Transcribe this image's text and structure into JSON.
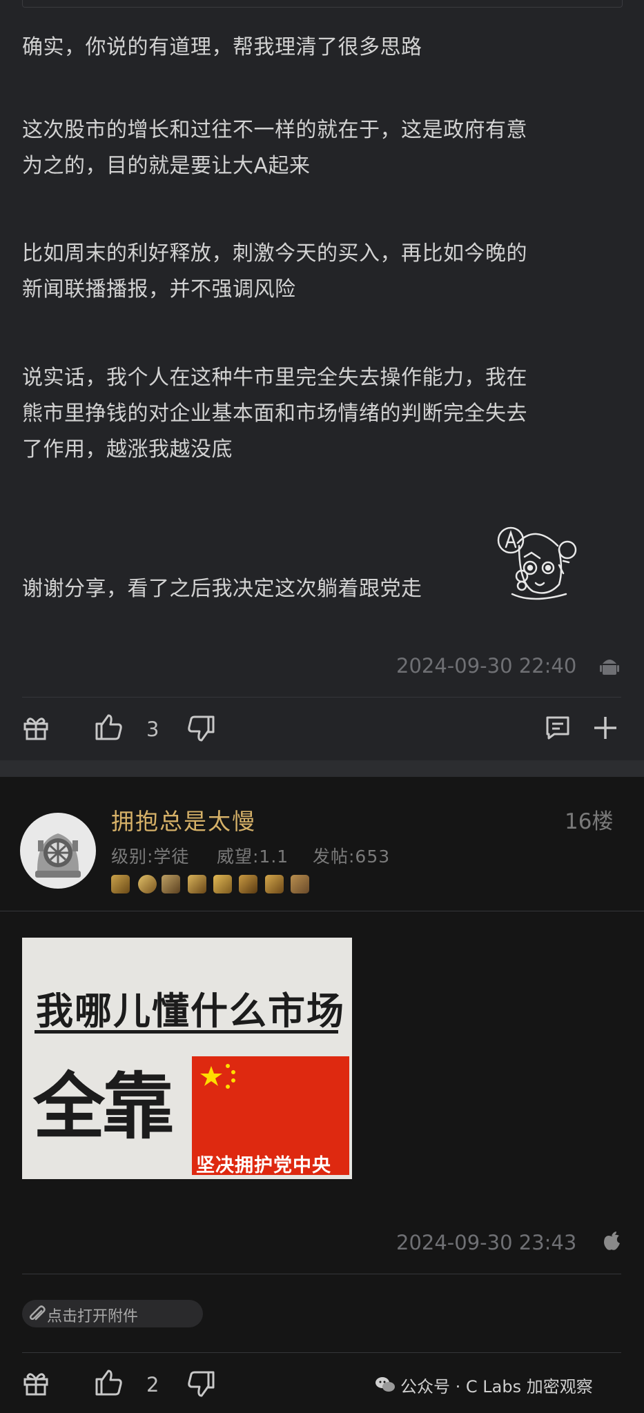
{
  "post_prev": {
    "paragraphs": [
      [
        "确实，你说的有道理，帮我理清了很多思路"
      ],
      [
        "这次股市的增长和过往不一样的就在于，这是政府有意",
        "为之的，目的就是要让大A起来"
      ],
      [
        "比如周末的利好释放，刺激今天的买入，再比如今晚的",
        "新闻联播播报，并不强调风险"
      ],
      [
        "说实话，我个人在这种牛市里完全失去操作能力，我在",
        "熊市里挣钱的对企业基本面和市场情绪的判断完全失去",
        "了作用，越涨我越没底"
      ]
    ],
    "reply_text": "谢谢分享，看了之后我决定这次躺着跟党走",
    "sticker_icon": "anime-girl-sticker",
    "timestamp": "2024-09-30 22:40",
    "device_icon": "android-icon",
    "like_count": "3"
  },
  "post_16": {
    "username": "拥抱总是太慢",
    "floor": "16楼",
    "level_label": "级别:学徒",
    "prestige_label": "威望:1.1",
    "posts_label": "发帖:653",
    "avatar_icon": "diving-helmet-avatar",
    "badges": [
      "badge-1",
      "badge-2",
      "badge-3",
      "badge-4",
      "badge-5",
      "badge-6",
      "badge-7",
      "badge-8"
    ],
    "image": {
      "line1": "我哪儿懂什么市场",
      "line2": "全靠",
      "flag_caption": "坚决拥护党中央",
      "flag_color": "#de2910",
      "star_color": "#ffde00"
    },
    "timestamp": "2024-09-30 23:43",
    "device_icon": "apple-icon",
    "attachment_label": "点击打开附件",
    "like_count": "2"
  },
  "watermark": "公众号 · C Labs 加密观察",
  "colors": {
    "accent_username": "#d6b168",
    "card_bg": "#232427",
    "page_bg": "#141414"
  }
}
